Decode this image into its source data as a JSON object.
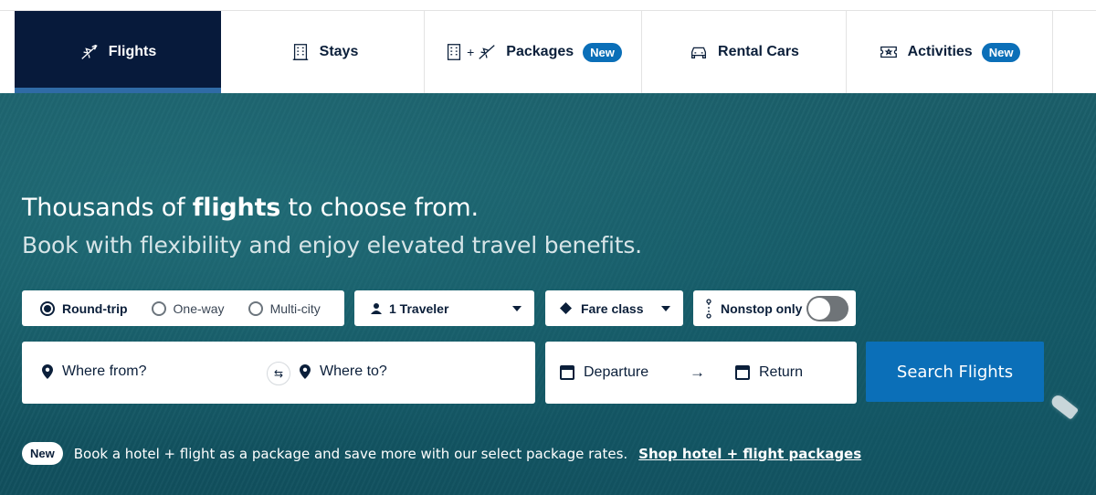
{
  "tabs": [
    {
      "label": "Flights",
      "icon": "plane-icon",
      "active": true
    },
    {
      "label": "Stays",
      "icon": "hotel-icon"
    },
    {
      "label": "Packages",
      "icon": "hotel-plus-plane-icon",
      "badge": "New"
    },
    {
      "label": "Rental Cars",
      "icon": "car-icon"
    },
    {
      "label": "Activities",
      "icon": "ticket-icon",
      "badge": "New"
    }
  ],
  "hero": {
    "headline_pre": "Thousands of ",
    "headline_bold": "flights",
    "headline_post": " to choose from.",
    "subhead": "Book with flexibility and enjoy elevated travel benefits."
  },
  "trip_type": {
    "options": [
      "Round-trip",
      "One-way",
      "Multi-city"
    ],
    "selected": "Round-trip"
  },
  "travelers": {
    "label": "1 Traveler"
  },
  "fare_class": {
    "label": "Fare class"
  },
  "nonstop": {
    "label": "Nonstop only",
    "enabled": false
  },
  "route": {
    "from_placeholder": "Where from?",
    "to_placeholder": "Where to?"
  },
  "dates": {
    "departure": "Departure",
    "return": "Return",
    "arrow": "→"
  },
  "search_button": "Search Flights",
  "promo": {
    "badge": "New",
    "text": "Book a hotel + flight as a package and save more with our select package rates.",
    "link": "Shop hotel + flight packages"
  },
  "colors": {
    "nav_dark": "#071a3b",
    "accent_blue": "#0b6fb8",
    "ocean": "#155a66"
  }
}
